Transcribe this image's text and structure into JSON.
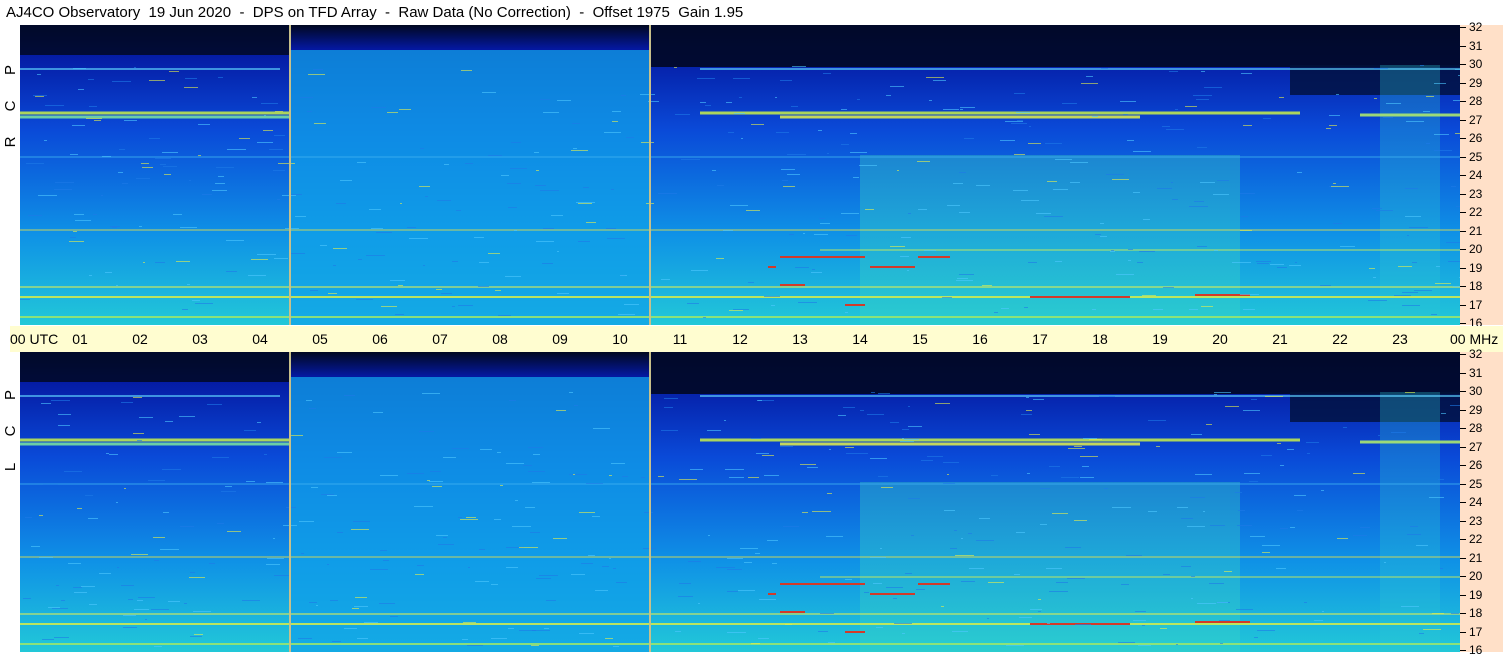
{
  "title": "AJ4CO Observatory  19 Jun 2020  -  DPS on TFD Array  -  Raw Data (No Correction)  -  Offset 1975  Gain 1.95",
  "panels": {
    "rcp": {
      "label": "R C P"
    },
    "lcp": {
      "label": "L C P"
    }
  },
  "time_axis": {
    "hours": [
      "00",
      "01",
      "02",
      "03",
      "04",
      "05",
      "06",
      "07",
      "08",
      "09",
      "10",
      "11",
      "12",
      "13",
      "14",
      "15",
      "16",
      "17",
      "18",
      "19",
      "20",
      "21",
      "22",
      "23",
      "00"
    ],
    "start_label": "00  UTC",
    "end_label": "00 MHz"
  },
  "freq_axis": {
    "ticks": [
      "32",
      "31",
      "30",
      "29",
      "28",
      "27",
      "26",
      "25",
      "24",
      "23",
      "22",
      "21",
      "20",
      "19",
      "18",
      "17",
      "16"
    ]
  },
  "colors": {
    "background": "#14a9e6",
    "dark_top": "#010a2a",
    "band_yellow": "#e4f04a",
    "band_red": "#d23a2a",
    "timebar": "#fffdd0",
    "freq_panel": "#ffe0c8",
    "marker_line": "#c8c08a"
  },
  "markers_utc": [
    "04:30",
    "10:30"
  ]
}
